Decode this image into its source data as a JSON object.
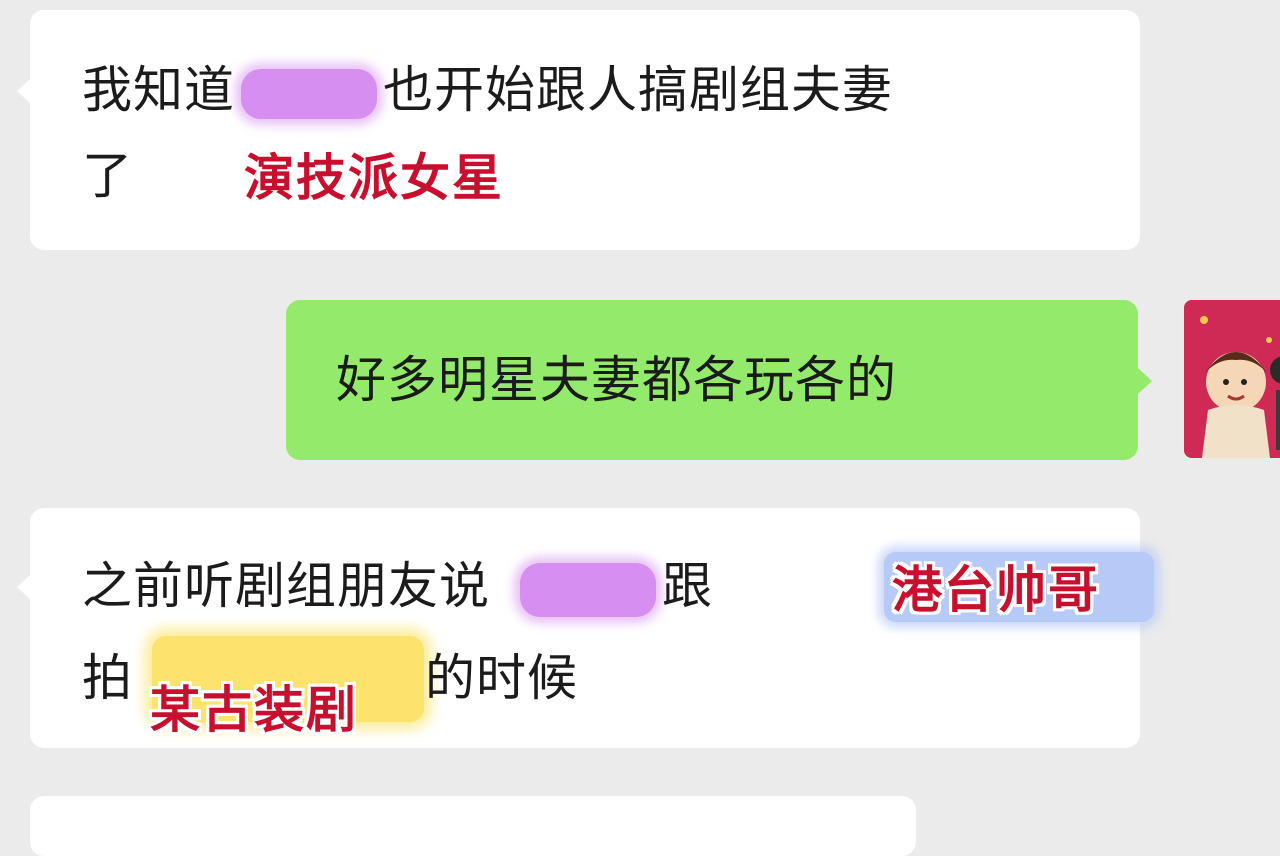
{
  "messages": [
    {
      "direction": "incoming",
      "line1_prefix": "我知道",
      "line1_suffix": "也开始跟人搞剧组夫妻",
      "line2": "了",
      "tag": "演技派女星"
    },
    {
      "direction": "outgoing",
      "text": "好多明星夫妻都各玩各的"
    },
    {
      "direction": "incoming",
      "line1_prefix": "之前听剧组朋友说",
      "line1_suffix": "跟",
      "tag1": "港台帅哥",
      "line2_prefix": "拍",
      "line2_suffix": "的时候",
      "tag2": "某古装剧"
    }
  ],
  "colors": {
    "background": "#ebebeb",
    "incoming_bubble": "#ffffff",
    "outgoing_bubble": "#94ea6a",
    "tag_red": "#c8102e",
    "redaction_purple": "#d68ef0",
    "highlight_blue": "#b7c9f6",
    "highlight_yellow": "#fbe36d"
  }
}
